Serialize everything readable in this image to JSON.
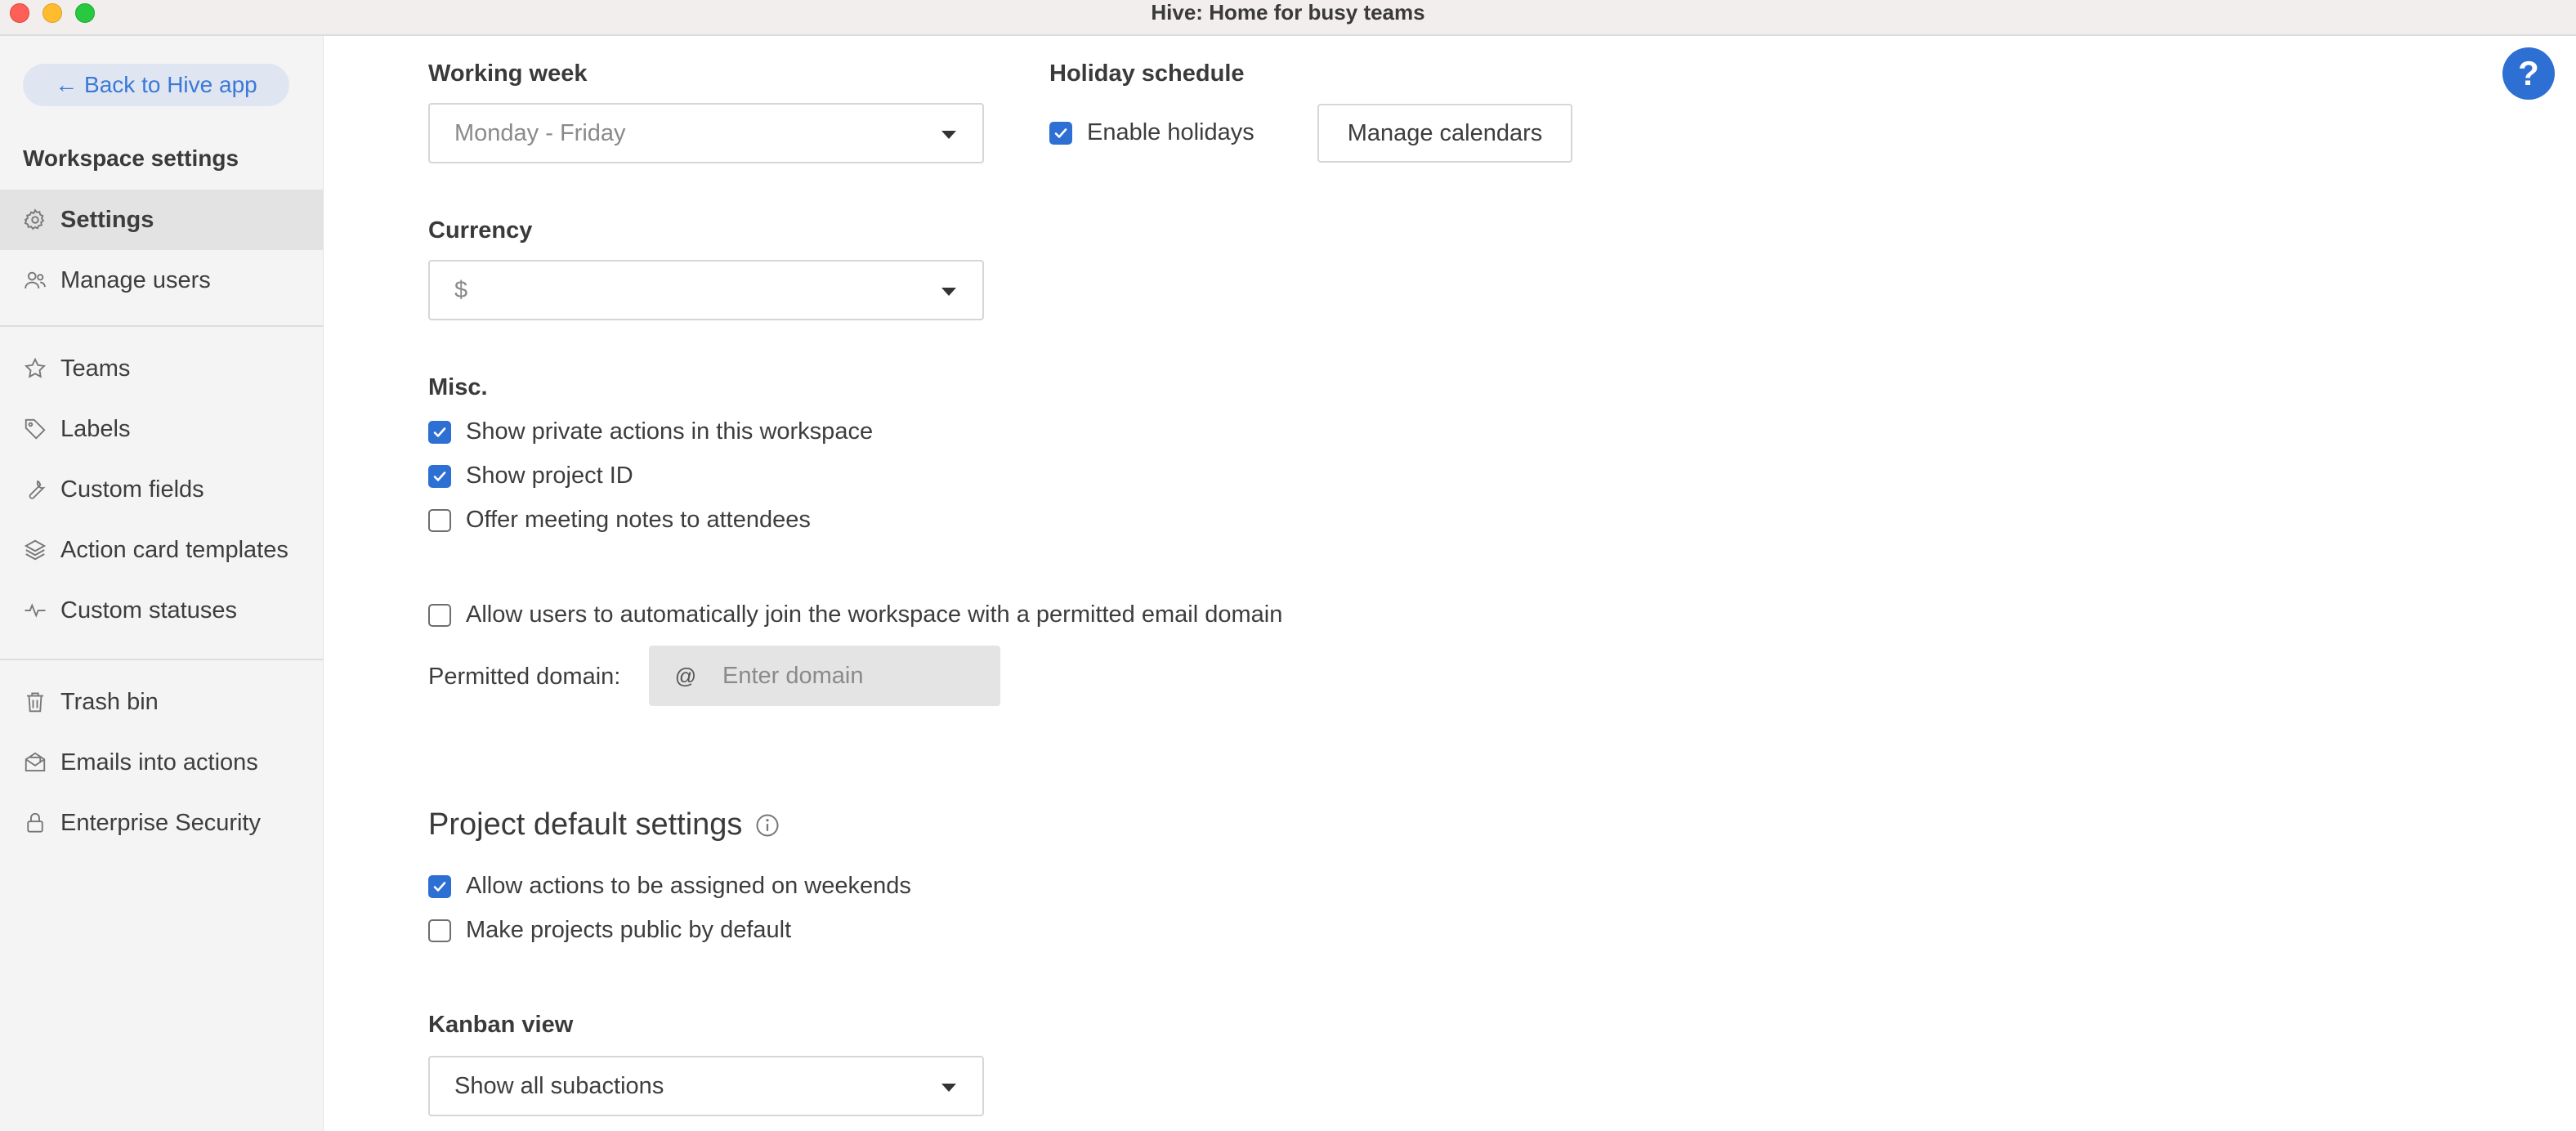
{
  "window": {
    "title": "Hive: Home for busy teams"
  },
  "sidebar": {
    "back_label": "← Back to Hive app",
    "heading": "Workspace settings",
    "items": [
      {
        "label": "Settings",
        "icon": "gear-icon",
        "active": true
      },
      {
        "label": "Manage users",
        "icon": "users-icon"
      },
      {
        "label": "Teams",
        "icon": "star-icon"
      },
      {
        "label": "Labels",
        "icon": "tag-icon"
      },
      {
        "label": "Custom fields",
        "icon": "wrench-icon"
      },
      {
        "label": "Action card templates",
        "icon": "layers-icon"
      },
      {
        "label": "Custom statuses",
        "icon": "pulse-icon"
      },
      {
        "label": "Trash bin",
        "icon": "trash-icon"
      },
      {
        "label": "Emails into actions",
        "icon": "envelope-icon"
      },
      {
        "label": "Enterprise Security",
        "icon": "lock-icon"
      }
    ]
  },
  "working_week": {
    "label": "Working week",
    "value": "Monday - Friday"
  },
  "holiday": {
    "label": "Holiday schedule",
    "enable_label": "Enable holidays",
    "enabled": true,
    "manage_label": "Manage calendars"
  },
  "currency": {
    "label": "Currency",
    "value": "$"
  },
  "misc": {
    "label": "Misc.",
    "options": [
      {
        "label": "Show private actions in this workspace",
        "checked": true
      },
      {
        "label": "Show project ID",
        "checked": true
      },
      {
        "label": "Offer meeting notes to attendees",
        "checked": false
      }
    ]
  },
  "auto_join": {
    "label": "Allow users to automatically join the workspace with a permitted email domain",
    "checked": false
  },
  "permitted_domain": {
    "label": "Permitted domain:",
    "prefix": "@",
    "placeholder": "Enter domain"
  },
  "project_defaults": {
    "title": "Project default settings",
    "options": [
      {
        "label": "Allow actions to be assigned on weekends",
        "checked": true
      },
      {
        "label": "Make projects public by default",
        "checked": false
      }
    ]
  },
  "kanban": {
    "label": "Kanban view",
    "value": "Show all subactions"
  },
  "help": {
    "label": "?"
  },
  "colors": {
    "accent": "#2d6fd2",
    "sidebar_bg": "#f4f4f4",
    "back_btn_bg": "#dfe6f2"
  }
}
